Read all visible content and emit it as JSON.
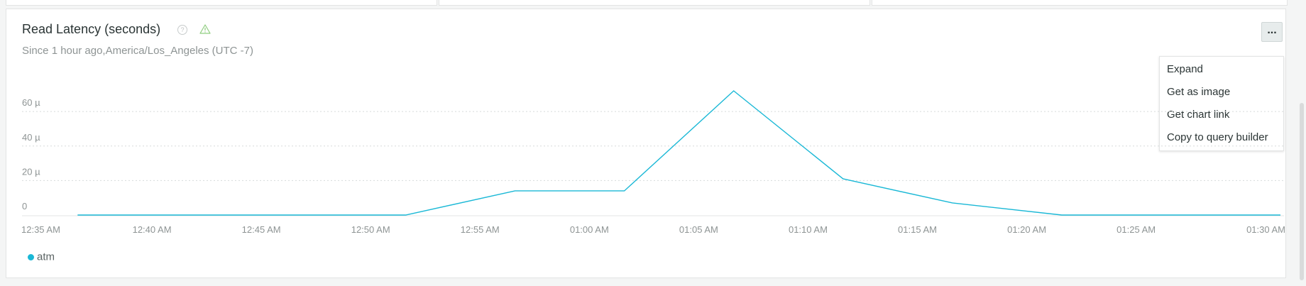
{
  "panel": {
    "title": "Read Latency (seconds)",
    "subtitle": "Since 1 hour ago,America/Los_Angeles (UTC -7)",
    "menu_button_label": "...",
    "help_icon": "question-circle-icon",
    "warning_icon": "warning-triangle-icon",
    "menu_items": [
      "Expand",
      "Get as image",
      "Get chart link",
      "Copy to query builder"
    ]
  },
  "colors": {
    "series": "#1ab8d6",
    "grid": "#d8dbdb",
    "axis_text": "#8e9494",
    "warning": "#8fcd7f"
  },
  "chart_data": {
    "type": "line",
    "unit_suffix": "µ",
    "y_ticks": [
      0,
      20,
      40,
      60
    ],
    "y_tick_labels": [
      "0",
      "20 µ",
      "40 µ",
      "60 µ"
    ],
    "ylim": [
      0,
      72
    ],
    "x_ticks": [
      "12:35 AM",
      "12:40 AM",
      "12:45 AM",
      "12:50 AM",
      "12:55 AM",
      "01:00 AM",
      "01:05 AM",
      "01:10 AM",
      "01:15 AM",
      "01:20 AM",
      "01:25 AM",
      "01:30 AM"
    ],
    "x_tick_minutes": [
      0,
      5,
      10,
      15,
      20,
      25,
      30,
      35,
      40,
      45,
      50,
      55
    ],
    "xlim": [
      0,
      56.6
    ],
    "grid": true,
    "legend_position": "bottom-left",
    "series": [
      {
        "name": "atm",
        "x": [
          1.6,
          16.6,
          21.6,
          26.6,
          31.6,
          36.6,
          41.6,
          46.6,
          51.6,
          56.6
        ],
        "y": [
          0,
          0,
          14,
          14,
          72,
          21,
          7,
          0,
          0,
          0
        ]
      }
    ]
  }
}
